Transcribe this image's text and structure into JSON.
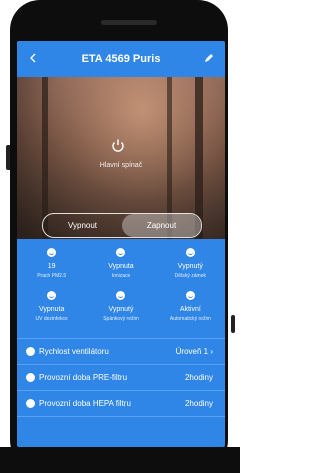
{
  "header": {
    "title": "ETA 4569 Puris"
  },
  "hero": {
    "power_label": "Hlavní spínač",
    "toggle_off": "Vypnout",
    "toggle_on": "Zapnout"
  },
  "status_row1": [
    {
      "value": "19",
      "label": "Prach PM2.5"
    },
    {
      "value": "Vypnuta",
      "label": "Ionizace"
    },
    {
      "value": "Vypnutý",
      "label": "Dětský zámek"
    }
  ],
  "status_row2": [
    {
      "value": "Vypnuta",
      "label": "UV dezinfekce"
    },
    {
      "value": "Vypnutý",
      "label": "Spánkový režim"
    },
    {
      "value": "Aktivní",
      "label": "Automatický režim"
    }
  ],
  "rows": [
    {
      "label": "Rychlost ventilátoru",
      "value": "Úroveň 1"
    },
    {
      "label": "Provozní doba PRE-filtru",
      "value": "2hodiny"
    },
    {
      "label": "Provozní doba HEPA filtru",
      "value": "2hodiny"
    }
  ]
}
